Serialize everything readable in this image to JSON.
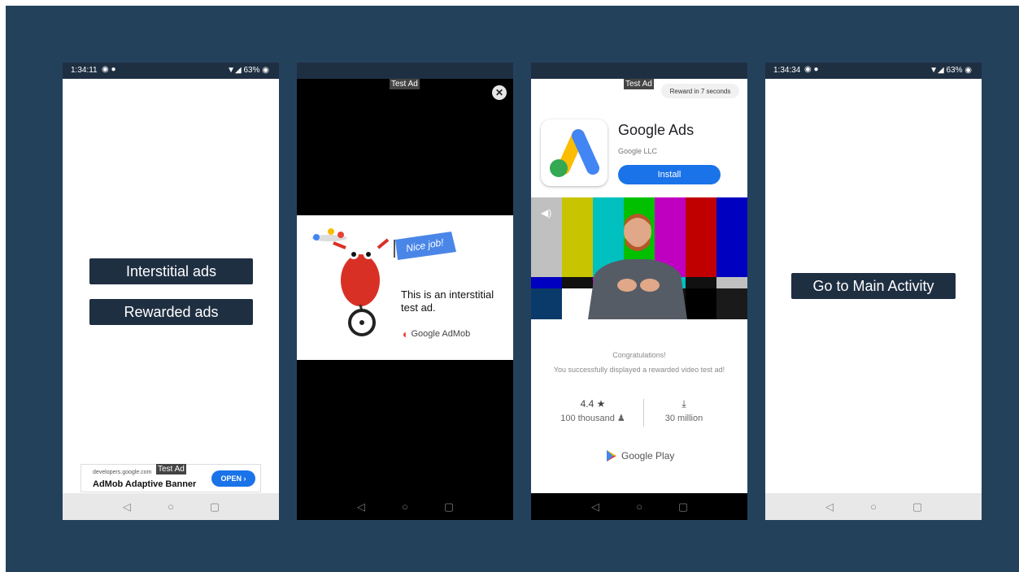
{
  "phone1": {
    "status": {
      "time": "1:34:11",
      "battery": "63%"
    },
    "buttons": {
      "interstitial": "Interstitial ads",
      "rewarded": "Rewarded ads"
    },
    "banner": {
      "url": "developers.google.com",
      "title": "AdMob Adaptive Banner",
      "open": "OPEN ›",
      "test_ad": "Test Ad"
    }
  },
  "phone2": {
    "test_ad": "Test Ad",
    "close": "✕",
    "flag": "Nice job!",
    "message": "This is an interstitial test ad.",
    "brand": "Google AdMob"
  },
  "phone3": {
    "test_ad": "Test Ad",
    "reward_countdown": "Reward in 7 seconds",
    "app_name": "Google Ads",
    "developer": "Google LLC",
    "install": "Install",
    "congrats_title": "Congratulations!",
    "congrats_body": "You successfully displayed a rewarded video test ad!",
    "rating": "4.4 ★",
    "rating_count": "100 thousand ♟",
    "downloads_icon": "⤓",
    "downloads": "30 million",
    "store": "Google Play"
  },
  "phone4": {
    "status": {
      "time": "1:34:34",
      "battery": "63%"
    },
    "button": "Go to Main Activity"
  },
  "nav": {
    "back": "◁",
    "home": "○",
    "recent": "▢"
  },
  "colors": {
    "background": "#24415c",
    "button": "#1f2f42",
    "accent": "#1a73e8"
  }
}
